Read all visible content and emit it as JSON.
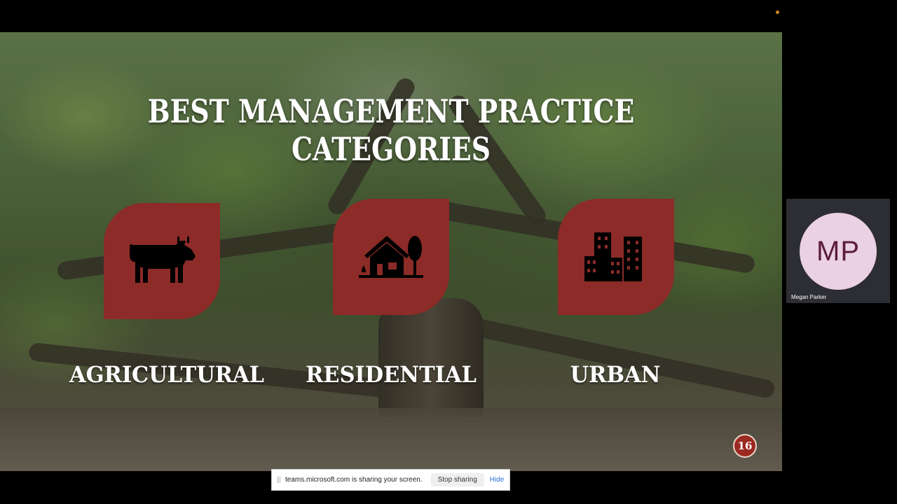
{
  "slide": {
    "title": "BEST MANAGEMENT PRACTICE CATEGORIES",
    "categories": [
      {
        "label": "AGRICULTURAL",
        "icon": "cow-icon"
      },
      {
        "label": "RESIDENTIAL",
        "icon": "house-tree-icon"
      },
      {
        "label": "URBAN",
        "icon": "city-buildings-icon"
      }
    ],
    "page_number": "16",
    "card_color": "#8c2b27"
  },
  "participant": {
    "initials": "MP",
    "name": "Megan Parker"
  },
  "share_bar": {
    "grip": "||",
    "message": "teams.microsoft.com is sharing your screen.",
    "stop_label": "Stop sharing",
    "hide_label": "Hide"
  }
}
